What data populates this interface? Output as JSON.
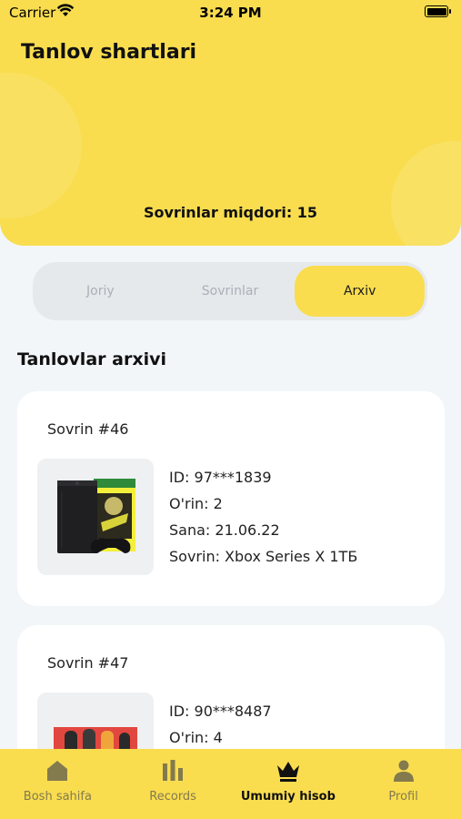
{
  "status_bar": {
    "carrier": "Carrier",
    "time": "3:24 PM"
  },
  "header": {
    "title": "Tanlov shartlari",
    "prize_count": "Sovrinlar miqdori: 15"
  },
  "tabs": [
    {
      "label": "Joriy"
    },
    {
      "label": "Sovrinlar"
    },
    {
      "label": "Arxiv"
    }
  ],
  "section_title": "Tanlovlar arxivi",
  "cards": [
    {
      "title": "Sovrin #46",
      "id": "ID: 97***1839",
      "place": "O'rin: 2",
      "date": "Sana: 21.06.22",
      "prize": "Sovrin: Xbox Series X 1ТБ"
    },
    {
      "title": "Sovrin #47",
      "id": "ID: 90***8487",
      "place": "O'rin: 4"
    }
  ],
  "bottom_nav": [
    {
      "label": "Bosh sahifa",
      "icon": "home-icon"
    },
    {
      "label": "Records",
      "icon": "bar-chart-icon"
    },
    {
      "label": "Umumiy hisob",
      "icon": "crown-icon"
    },
    {
      "label": "Profil",
      "icon": "person-icon"
    }
  ],
  "colors": {
    "accent": "#f9dd4f",
    "background": "#f3f6f9",
    "inactive": "#837a4e"
  }
}
